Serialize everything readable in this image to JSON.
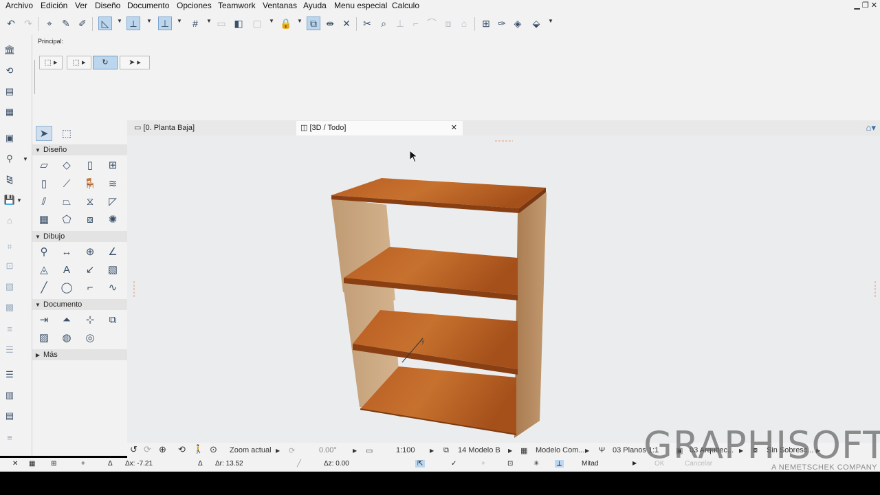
{
  "menu": [
    "Archivo",
    "Edición",
    "Ver",
    "Diseño",
    "Documento",
    "Opciones",
    "Teamwork",
    "Ventanas",
    "Ayuda",
    "Menu especial",
    "Calculo"
  ],
  "info_box": {
    "label": "Principal:"
  },
  "toolbox": {
    "sections": {
      "diseno": "Diseño",
      "dibujo": "Dibujo",
      "documento": "Documento",
      "mas": "Más"
    }
  },
  "tabs": [
    {
      "label": "[0. Planta Baja]",
      "active": false
    },
    {
      "label": "[3D / Todo]",
      "active": true
    }
  ],
  "statusbar": {
    "zoom_label": "Zoom actual",
    "angle": "0.00°",
    "scale": "1:100",
    "layer_combo": "14 Modelo B",
    "model_view": "Modelo Com...",
    "pen_set": "03 Planos 1:1",
    "dimension": "03 Arquitec...",
    "overrides": "Sin Sobresc..."
  },
  "coords": {
    "dx": "Δx: -7.21",
    "dr": "Δr: 13.52",
    "dz": "Δz: 0.00",
    "snap": "Mitad",
    "ok": "OK",
    "cancel": "Cancelar"
  },
  "watermark": {
    "brand": "GRAPHISOFT",
    "sub": "A NEMETSCHEK COMPANY"
  },
  "colors": {
    "accent": "#bcd6ee",
    "wood_dark": "#9a4a16",
    "wood_light": "#c66d2a",
    "side_panel": "#c8a57e"
  }
}
